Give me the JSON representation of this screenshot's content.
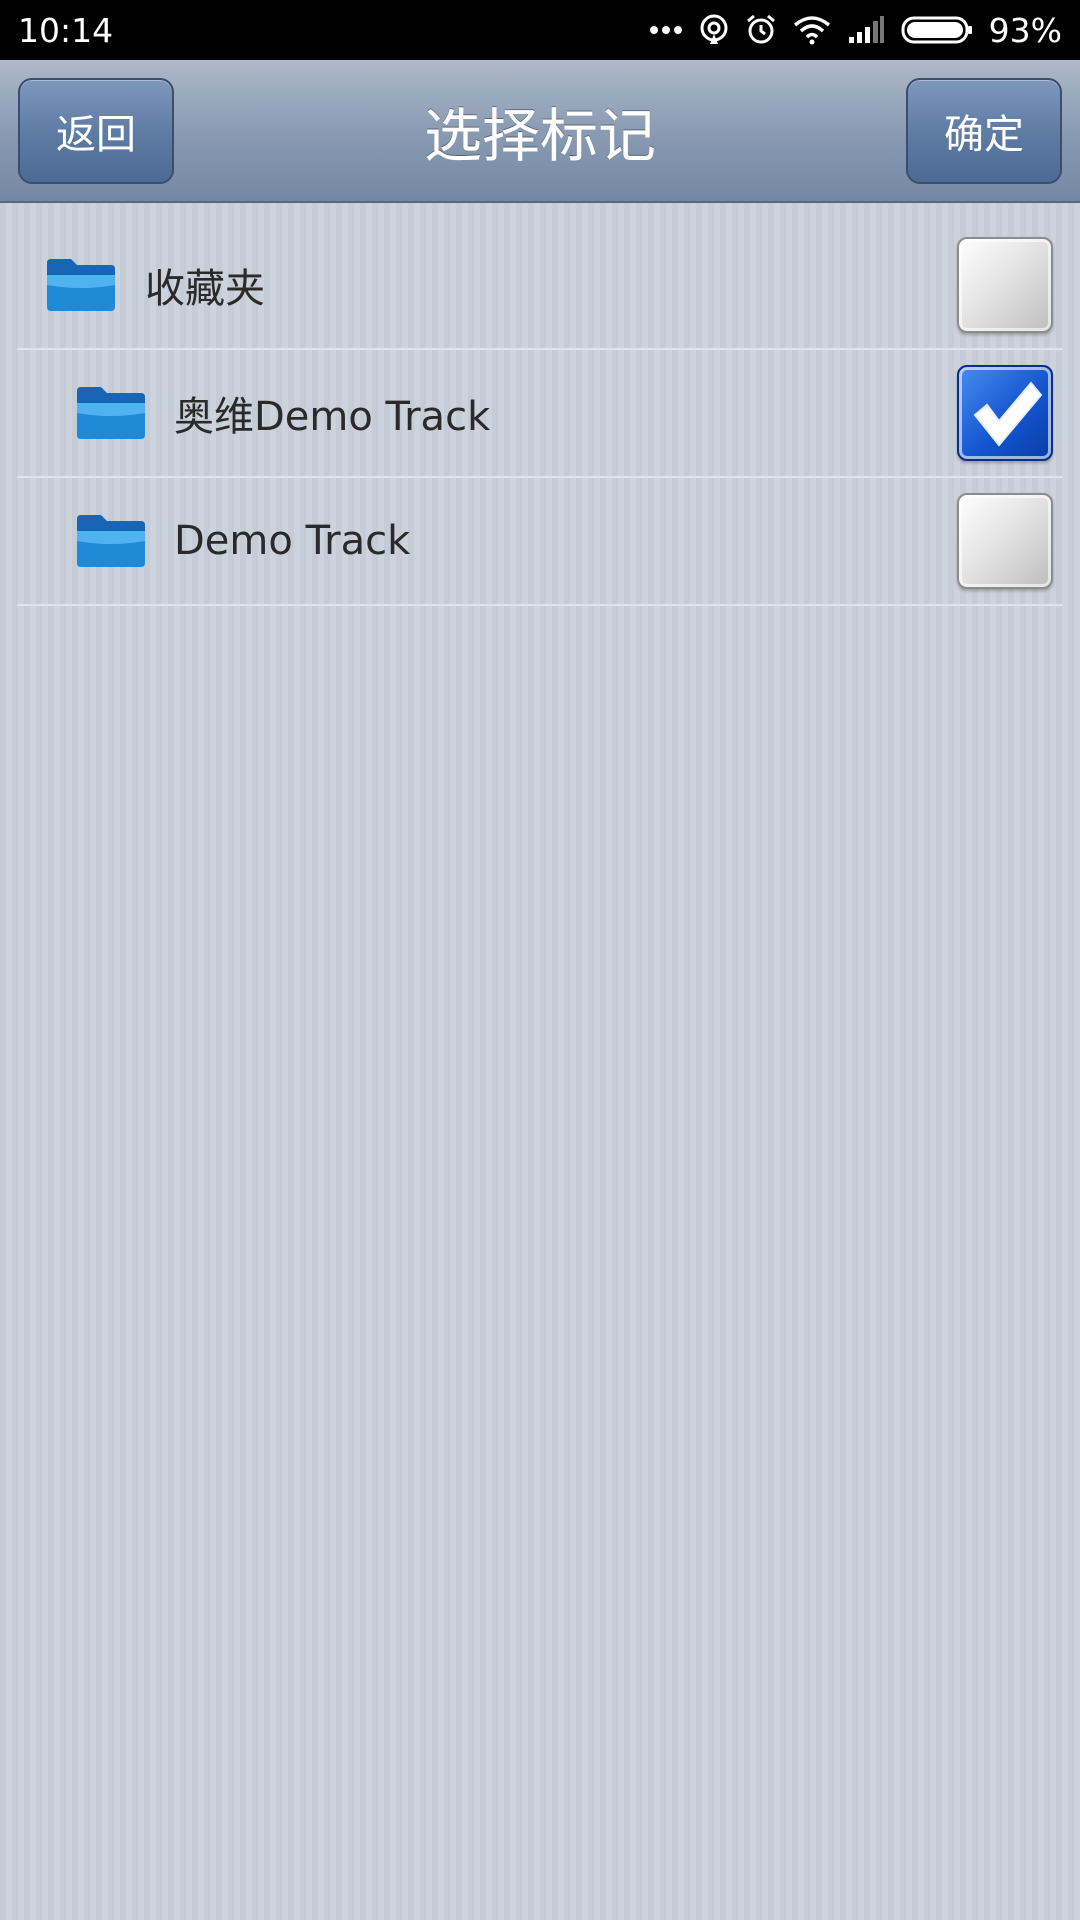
{
  "status_bar": {
    "time": "10:14",
    "battery_percent": "93%",
    "icons": [
      "more-dots-icon",
      "hotspot-icon",
      "alarm-icon",
      "wifi-icon",
      "signal-icon",
      "battery-icon"
    ]
  },
  "header": {
    "title": "选择标记",
    "back_label": "返回",
    "confirm_label": "确定"
  },
  "list": {
    "items": [
      {
        "label": "收藏夹",
        "icon": "folder-icon",
        "checked": false,
        "level": 0
      },
      {
        "label": "奥维Demo Track",
        "icon": "folder-icon",
        "checked": true,
        "level": 1
      },
      {
        "label": "Demo Track",
        "icon": "folder-icon",
        "checked": false,
        "level": 1
      }
    ]
  },
  "colors": {
    "header_gradient_top": "#aeb9c9",
    "header_gradient_bottom": "#7488a5",
    "button_blue": "#5f7ca5",
    "checkbox_checked": "#1456d0",
    "folder_blue": "#1e8ad6"
  }
}
